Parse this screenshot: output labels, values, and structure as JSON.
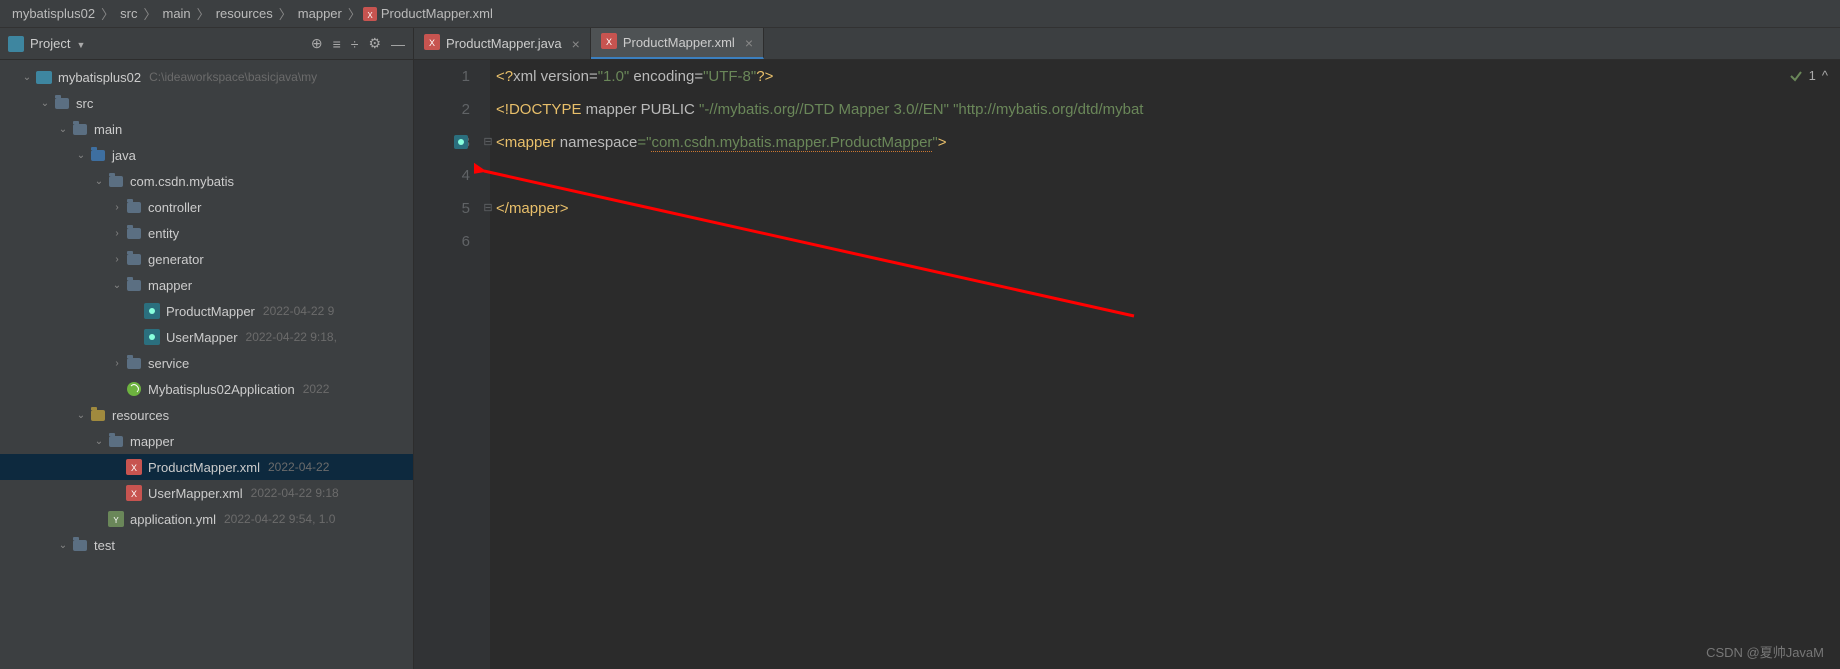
{
  "breadcrumb": [
    "mybatisplus02",
    "src",
    "main",
    "resources",
    "mapper",
    "ProductMapper.xml"
  ],
  "sidebar": {
    "title": "Project",
    "tree": [
      {
        "indent": 0,
        "chev": "v",
        "icon": "root",
        "label": "mybatisplus02",
        "meta": "C:\\ideaworkspace\\basicjava\\my"
      },
      {
        "indent": 1,
        "chev": "v",
        "icon": "folder",
        "label": "src"
      },
      {
        "indent": 2,
        "chev": "v",
        "icon": "folder",
        "label": "main"
      },
      {
        "indent": 3,
        "chev": "v",
        "icon": "java",
        "label": "java"
      },
      {
        "indent": 4,
        "chev": "v",
        "icon": "pkg",
        "label": "com.csdn.mybatis"
      },
      {
        "indent": 5,
        "chev": ">",
        "icon": "pkg",
        "label": "controller"
      },
      {
        "indent": 5,
        "chev": ">",
        "icon": "pkg",
        "label": "entity"
      },
      {
        "indent": 5,
        "chev": ">",
        "icon": "pkg",
        "label": "generator"
      },
      {
        "indent": 5,
        "chev": "v",
        "icon": "pkg",
        "label": "mapper"
      },
      {
        "indent": 6,
        "chev": "",
        "icon": "mapper",
        "label": "ProductMapper",
        "meta": "2022-04-22 9"
      },
      {
        "indent": 6,
        "chev": "",
        "icon": "mapper",
        "label": "UserMapper",
        "meta": "2022-04-22 9:18,"
      },
      {
        "indent": 5,
        "chev": ">",
        "icon": "pkg",
        "label": "service"
      },
      {
        "indent": 5,
        "chev": "",
        "icon": "spring",
        "label": "Mybatisplus02Application",
        "meta": "2022"
      },
      {
        "indent": 3,
        "chev": "v",
        "icon": "res",
        "label": "resources"
      },
      {
        "indent": 4,
        "chev": "v",
        "icon": "folder",
        "label": "mapper"
      },
      {
        "indent": 5,
        "chev": "",
        "icon": "xml",
        "label": "ProductMapper.xml",
        "meta": "2022-04-22",
        "selected": true
      },
      {
        "indent": 5,
        "chev": "",
        "icon": "xml",
        "label": "UserMapper.xml",
        "meta": "2022-04-22 9:18"
      },
      {
        "indent": 4,
        "chev": "",
        "icon": "yml",
        "label": "application.yml",
        "meta": "2022-04-22 9:54, 1.0"
      },
      {
        "indent": 2,
        "chev": "v",
        "icon": "folder",
        "label": "test"
      }
    ]
  },
  "tabs": [
    {
      "icon": "xml",
      "label": "ProductMapper.java",
      "active": false
    },
    {
      "icon": "xml",
      "label": "ProductMapper.xml",
      "active": true
    }
  ],
  "code": {
    "lines": [
      "1",
      "2",
      "3",
      "4",
      "5",
      "6"
    ],
    "l1a": "<?",
    "l1b": "xml version",
    "l1c": "=",
    "l1d": "\"1.0\"",
    "l1e": " encoding",
    "l1f": "=",
    "l1g": "\"UTF-8\"",
    "l1h": "?>",
    "l2a": "<!",
    "l2b": "DOCTYPE ",
    "l2c": "mapper PUBLIC ",
    "l2d": "\"-//mybatis.org//DTD Mapper 3.0//EN\" \"http://mybatis.org/dtd/mybat",
    "l3a": "<",
    "l3b": "mapper ",
    "l3c": "namespace",
    "l3d": "=",
    "l3e": "\"",
    "l3f": "com.csdn.mybatis.mapper.ProductMapper",
    "l3g": "\"",
    "l3h": ">",
    "l5a": "</",
    "l5b": "mapper",
    "l5c": ">"
  },
  "inspection": {
    "count": "1",
    "expand": "^"
  },
  "watermark": "CSDN @夏帅JavaM"
}
